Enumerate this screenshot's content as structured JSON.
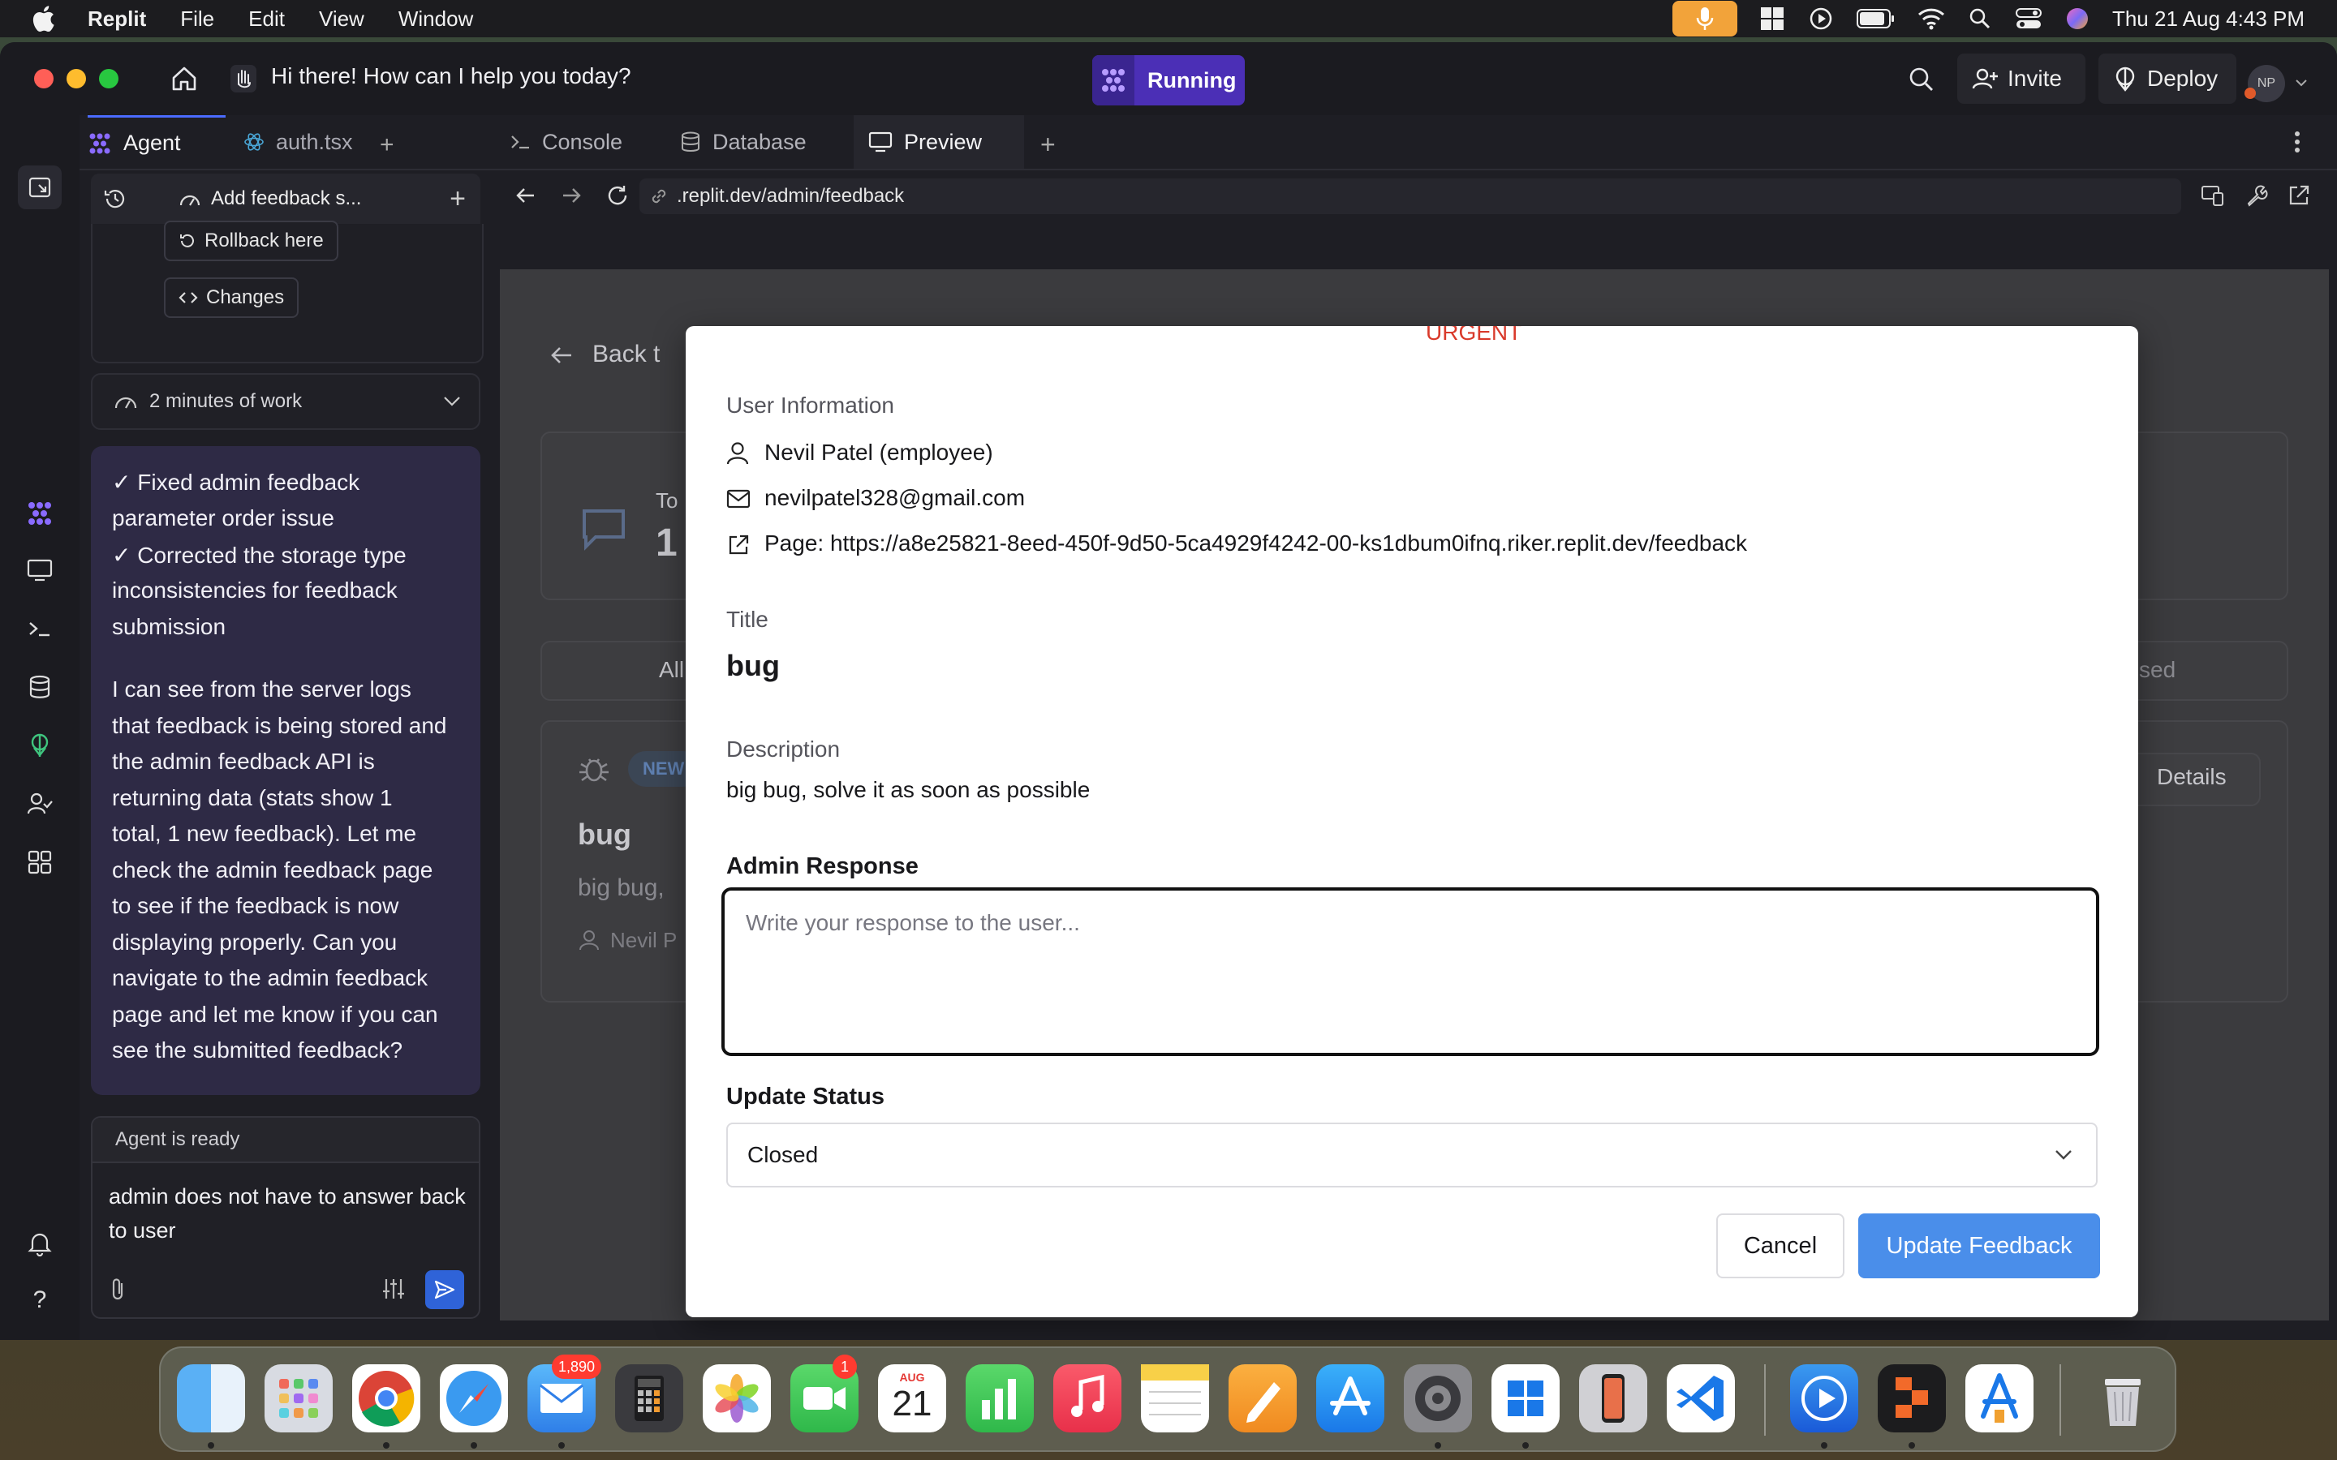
{
  "menubar": {
    "app_name": "Replit",
    "menus": [
      "File",
      "Edit",
      "View",
      "Window"
    ],
    "clock": "Thu 21 Aug  4:43 PM"
  },
  "window": {
    "title": "Hi there! How can I help you today?",
    "run_status": "Running",
    "invite_label": "Invite",
    "deploy_label": "Deploy",
    "avatar_initials": "NP"
  },
  "agent_pane": {
    "tabs": [
      "Agent",
      "auth.tsx"
    ],
    "session_title": "Add feedback s...",
    "rollback_label": "Rollback here",
    "changes_label": "Changes",
    "work_time": "2 minutes of work",
    "message_lines": [
      "✓ Fixed admin feedback",
      "parameter order issue",
      "✓ Corrected the storage type",
      "inconsistencies for feedback",
      "submission",
      "",
      "I can see from the server logs",
      "that feedback is being stored and",
      "the admin feedback API is",
      "returning data (stats show 1",
      "total, 1 new feedback). Let me",
      "check the admin feedback page",
      "to see if the feedback is now",
      "displaying properly. Can you",
      "navigate to the admin feedback",
      "page and let me know if you can",
      "see the submitted feedback?"
    ],
    "composer_status": "Agent is ready",
    "composer_text": "admin does not have to answer back to user"
  },
  "preview_pane": {
    "tabs": [
      "Console",
      "Database",
      "Preview"
    ],
    "url": ".replit.dev/admin/feedback",
    "background_page": {
      "back_label": "Back t",
      "stat_label": "To",
      "stat_value": "1",
      "filter_left": "All",
      "filter_right": "sed",
      "badge": "NEW",
      "card_title": "bug",
      "card_desc": "big bug,",
      "card_user": "Nevil P",
      "details_btn": "Details"
    }
  },
  "modal": {
    "priority": "URGENT",
    "user_info_label": "User Information",
    "user_name": "Nevil Patel (employee)",
    "user_email": "nevilpatel328@gmail.com",
    "page_url": "Page: https://a8e25821-8eed-450f-9d50-5ca4929f4242-00-ks1dbum0ifnq.riker.replit.dev/feedback",
    "title_label": "Title",
    "title_value": "bug",
    "description_label": "Description",
    "description_value": "big bug, solve it as soon as possible",
    "admin_response_label": "Admin Response",
    "admin_response_value": "",
    "admin_response_placeholder": "Write your response to the user...",
    "status_label": "Update Status",
    "status_value": "Closed",
    "cancel_label": "Cancel",
    "submit_label": "Update Feedback"
  },
  "dock": {
    "mail_badge": "1,890",
    "facetime_badge": "1",
    "calendar_month": "AUG",
    "calendar_day": "21"
  },
  "colors": {
    "accent_purple": "#4b2fb6",
    "primary_button": "#4a8eea",
    "priority_red": "#d93a2b",
    "agent_message_bg": "#2e2a45"
  }
}
